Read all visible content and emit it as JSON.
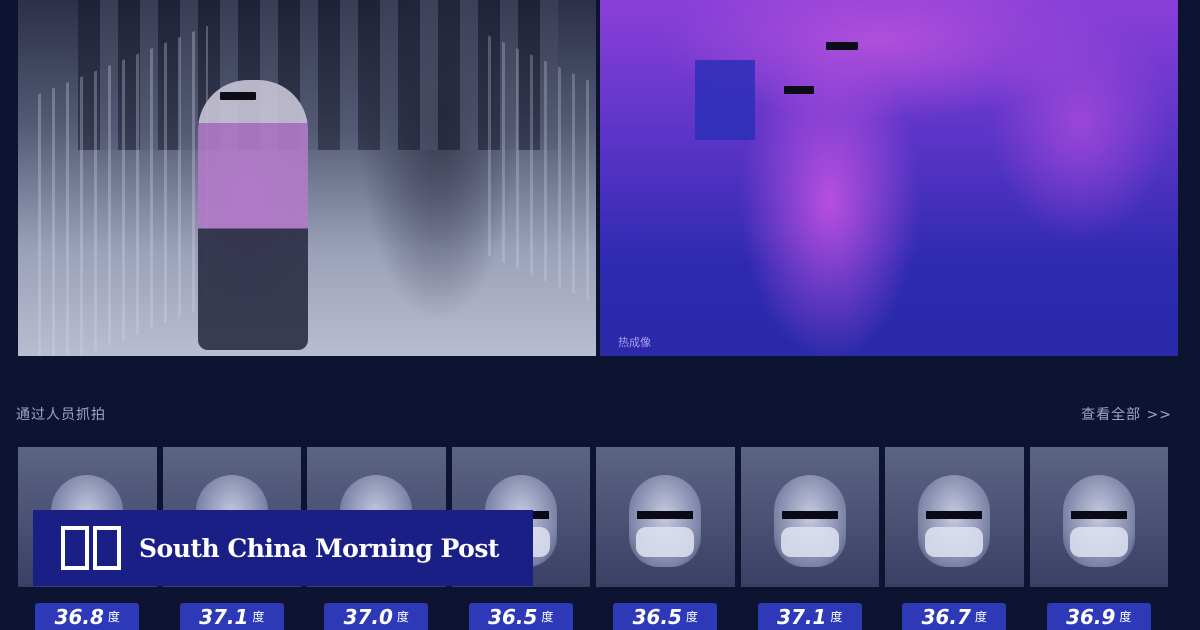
{
  "feeds": {
    "thermal_label": "热成像"
  },
  "captures": {
    "title": "通过人员抓拍",
    "view_all": "查看全部 >>",
    "temperature_unit": "度",
    "items": [
      {
        "temperature": "36.8"
      },
      {
        "temperature": "37.1"
      },
      {
        "temperature": "37.0"
      },
      {
        "temperature": "36.5"
      },
      {
        "temperature": "36.5"
      },
      {
        "temperature": "37.1"
      },
      {
        "temperature": "36.7"
      },
      {
        "temperature": "36.9"
      }
    ]
  },
  "branding": {
    "name": "South China Morning Post"
  },
  "colors": {
    "background": "#0d1432",
    "temperature_badge": "#2e39b8",
    "logo_background": "#1a1f86"
  }
}
